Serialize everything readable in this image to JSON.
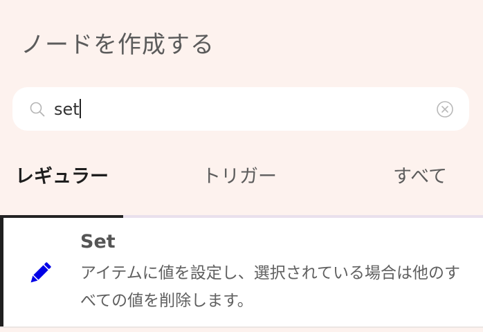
{
  "panel": {
    "title": "ノードを作成する"
  },
  "search": {
    "value": "set",
    "search_icon": "search-icon",
    "clear_icon": "clear-circle-icon"
  },
  "tabs": [
    {
      "label": "レギュラー",
      "active": true
    },
    {
      "label": "トリガー",
      "active": false
    },
    {
      "label": "すべて",
      "active": false
    }
  ],
  "results": [
    {
      "title": "Set",
      "description": "アイテムに値を設定し、選択されている場合は他のすべての値を削除します。",
      "icon": "pencil-icon",
      "icon_color": "#0000e6"
    }
  ],
  "colors": {
    "background": "#fdf2ee",
    "active_indicator": "#232323",
    "accent_bar": "#1f1f1f"
  }
}
